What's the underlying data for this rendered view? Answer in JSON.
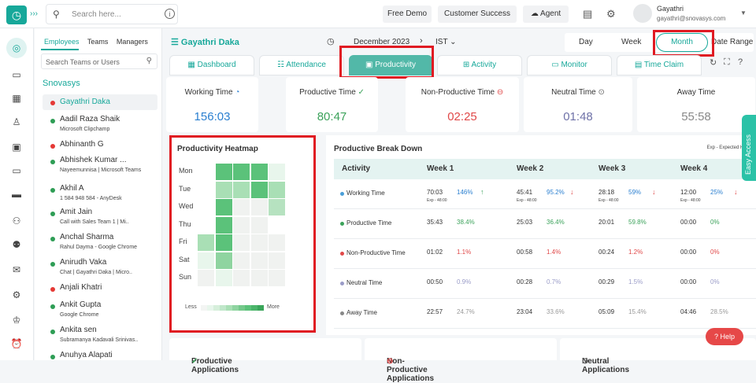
{
  "topbar": {
    "search_placeholder": "Search here...",
    "free_demo": "Free Demo",
    "customer_success": "Customer Success",
    "agent": "Agent",
    "user_name": "Gayathri",
    "user_email": "gayathri@snovasys.com"
  },
  "sidebar": {
    "tabs": [
      "Employees",
      "Teams",
      "Managers"
    ],
    "search_placeholder": "Search Teams or Users",
    "org": "Snovasys",
    "employees": [
      {
        "name": "Gayathri Daka",
        "sub": "",
        "status": "#e53935"
      },
      {
        "name": "Aadil Raza Shaik",
        "sub": "Microsoft Clipchamp",
        "status": "#2e9d55"
      },
      {
        "name": "Abhinanth G",
        "sub": "",
        "status": "#e53935"
      },
      {
        "name": "Abhishek Kumar ...",
        "sub": "Nayeemunnisa | Microsoft Teams",
        "status": "#2e9d55"
      },
      {
        "name": "Akhil A",
        "sub": "1 584 948 584 - AnyDesk",
        "status": "#2e9d55"
      },
      {
        "name": "Amit Jain",
        "sub": "Call with Sales Team 1 | Mi..",
        "status": "#2e9d55"
      },
      {
        "name": "Anchal Sharma",
        "sub": "Rahul Dayma - Google Chrome",
        "status": "#2e9d55"
      },
      {
        "name": "Anirudh Vaka",
        "sub": "Chat | Gayathri Daka | Micro..",
        "status": "#2e9d55"
      },
      {
        "name": "Anjali Khatri",
        "sub": "",
        "status": "#e53935"
      },
      {
        "name": "Ankit Gupta",
        "sub": "Google Chrome",
        "status": "#2e9d55"
      },
      {
        "name": "Ankita sen",
        "sub": "Subramanya Kadavali Srinivas..",
        "status": "#2e9d55"
      },
      {
        "name": "Anuhya Alapati",
        "sub": "",
        "status": "#2e9d55"
      }
    ]
  },
  "header": {
    "employee": "Gayathri Daka",
    "month": "December 2023",
    "timezone": "IST",
    "ranges": [
      "Day",
      "Week",
      "Month",
      "Date Range"
    ]
  },
  "tabs": [
    "Dashboard",
    "Attendance",
    "Productivity",
    "Activity",
    "Monitor",
    "Time Claim"
  ],
  "cards": [
    {
      "title": "Working Time",
      "value": "156:03",
      "color": "#2a7fd0"
    },
    {
      "title": "Productive Time",
      "value": "80:47",
      "color": "#3ba25a"
    },
    {
      "title": "Non-Productive Time",
      "value": "02:25",
      "color": "#e04848"
    },
    {
      "title": "Neutral Time",
      "value": "01:48",
      "color": "#6f72a8"
    },
    {
      "title": "Away Time",
      "value": "55:58",
      "color": "#888888"
    }
  ],
  "heatmap": {
    "title": "Productivity Heatmap",
    "days": [
      "Mon",
      "Tue",
      "Wed",
      "Thu",
      "Fri",
      "Sat",
      "Sun"
    ],
    "legend_less": "Less",
    "legend_more": "More"
  },
  "breakdown": {
    "title": "Productive Break Down",
    "note": "Exp - Expected Hours",
    "columns": [
      "Activity",
      "Week 1",
      "Week 2",
      "Week 3",
      "Week 4"
    ],
    "rows": [
      {
        "label": "Working Time",
        "dot": "#4a9ed8",
        "cells": [
          {
            "v": "70:03",
            "p": "146%",
            "arrow": "↑",
            "exp": "Exp - 48:00",
            "pc": "#2a7fd0",
            "ac": "#3ba25a"
          },
          {
            "v": "45:41",
            "p": "95.2%",
            "arrow": "↓",
            "exp": "Exp - 48:00",
            "pc": "#2a7fd0",
            "ac": "#e04848"
          },
          {
            "v": "28:18",
            "p": "59%",
            "arrow": "↓",
            "exp": "Exp - 48:00",
            "pc": "#2a7fd0",
            "ac": "#e04848"
          },
          {
            "v": "12:00",
            "p": "25%",
            "arrow": "↓",
            "exp": "Exp - 48:00",
            "pc": "#2a7fd0",
            "ac": "#e04848"
          }
        ]
      },
      {
        "label": "Productive Time",
        "dot": "#3ba25a",
        "cells": [
          {
            "v": "35:43",
            "p": "38.4%",
            "pc": "#3ba25a"
          },
          {
            "v": "25:03",
            "p": "36.4%",
            "pc": "#3ba25a"
          },
          {
            "v": "20:01",
            "p": "59.8%",
            "pc": "#3ba25a"
          },
          {
            "v": "00:00",
            "p": "0%",
            "pc": "#3ba25a"
          }
        ]
      },
      {
        "label": "Non-Productive Time",
        "dot": "#e04848",
        "cells": [
          {
            "v": "01:02",
            "p": "1.1%",
            "pc": "#e04848"
          },
          {
            "v": "00:58",
            "p": "1.4%",
            "pc": "#e04848"
          },
          {
            "v": "00:24",
            "p": "1.2%",
            "pc": "#e04848"
          },
          {
            "v": "00:00",
            "p": "0%",
            "pc": "#e04848"
          }
        ]
      },
      {
        "label": "Neutral Time",
        "dot": "#9a9cc8",
        "cells": [
          {
            "v": "00:50",
            "p": "0.9%",
            "pc": "#9a9cc8"
          },
          {
            "v": "00:28",
            "p": "0.7%",
            "pc": "#9a9cc8"
          },
          {
            "v": "00:29",
            "p": "1.5%",
            "pc": "#9a9cc8"
          },
          {
            "v": "00:00",
            "p": "0%",
            "pc": "#9a9cc8"
          }
        ]
      },
      {
        "label": "Away Time",
        "dot": "#888888",
        "cells": [
          {
            "v": "22:57",
            "p": "24.7%",
            "pc": "#999999"
          },
          {
            "v": "23:04",
            "p": "33.6%",
            "pc": "#999999"
          },
          {
            "v": "05:09",
            "p": "15.4%",
            "pc": "#999999"
          },
          {
            "v": "04:46",
            "p": "28.5%",
            "pc": "#999999"
          }
        ]
      }
    ]
  },
  "bottom": [
    "Productive Applications",
    "Non-Productive Applications",
    "Neutral Applications"
  ],
  "easy_access": "Easy Access",
  "help": "Help"
}
